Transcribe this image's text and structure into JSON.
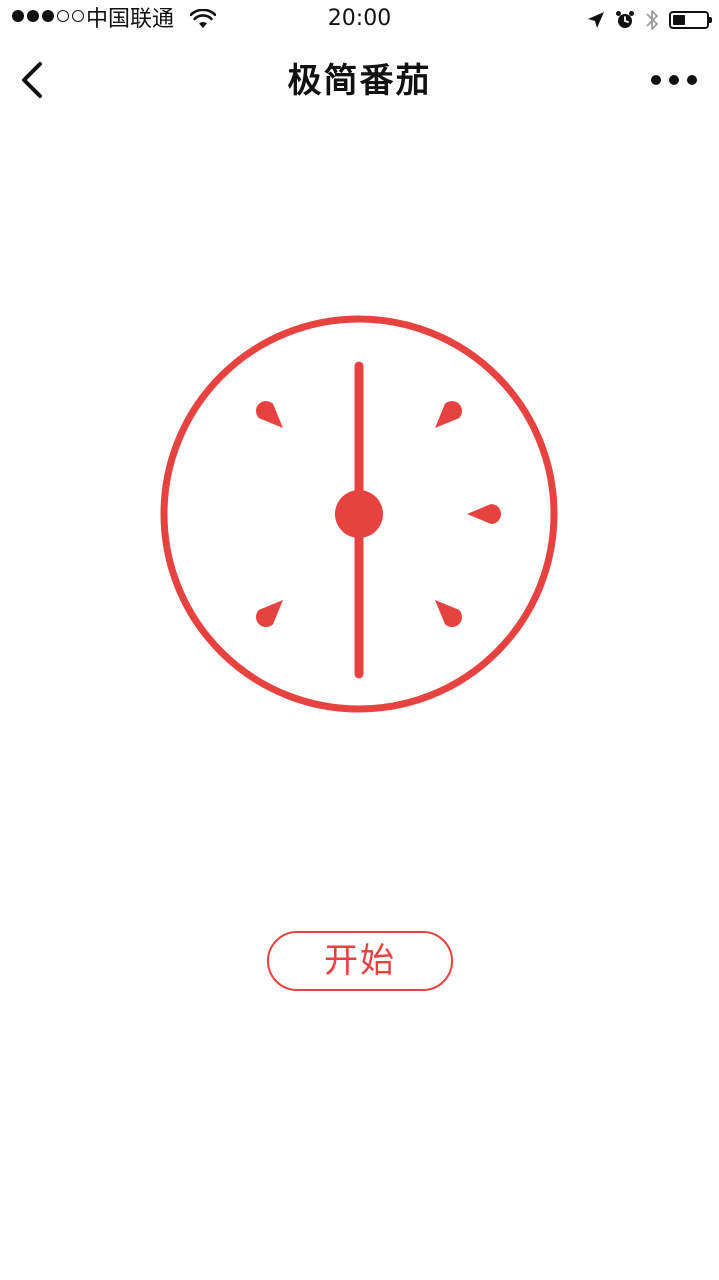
{
  "status_bar": {
    "carrier": "中国联通",
    "time": "20:00",
    "signal_bars_filled": 3,
    "signal_bars_total": 5,
    "icons": [
      "signal-dots",
      "wifi-icon",
      "location-arrow-icon",
      "alarm-icon",
      "bluetooth-icon",
      "battery-icon"
    ],
    "battery_level": 0.35
  },
  "nav": {
    "title": "极简番茄",
    "back_icon": "chevron-left-icon",
    "more_icon": "ellipsis-icon"
  },
  "timer": {
    "icon": "tomato-clock-face",
    "accent_color": "#e64340"
  },
  "actions": {
    "start_label": "开始"
  }
}
